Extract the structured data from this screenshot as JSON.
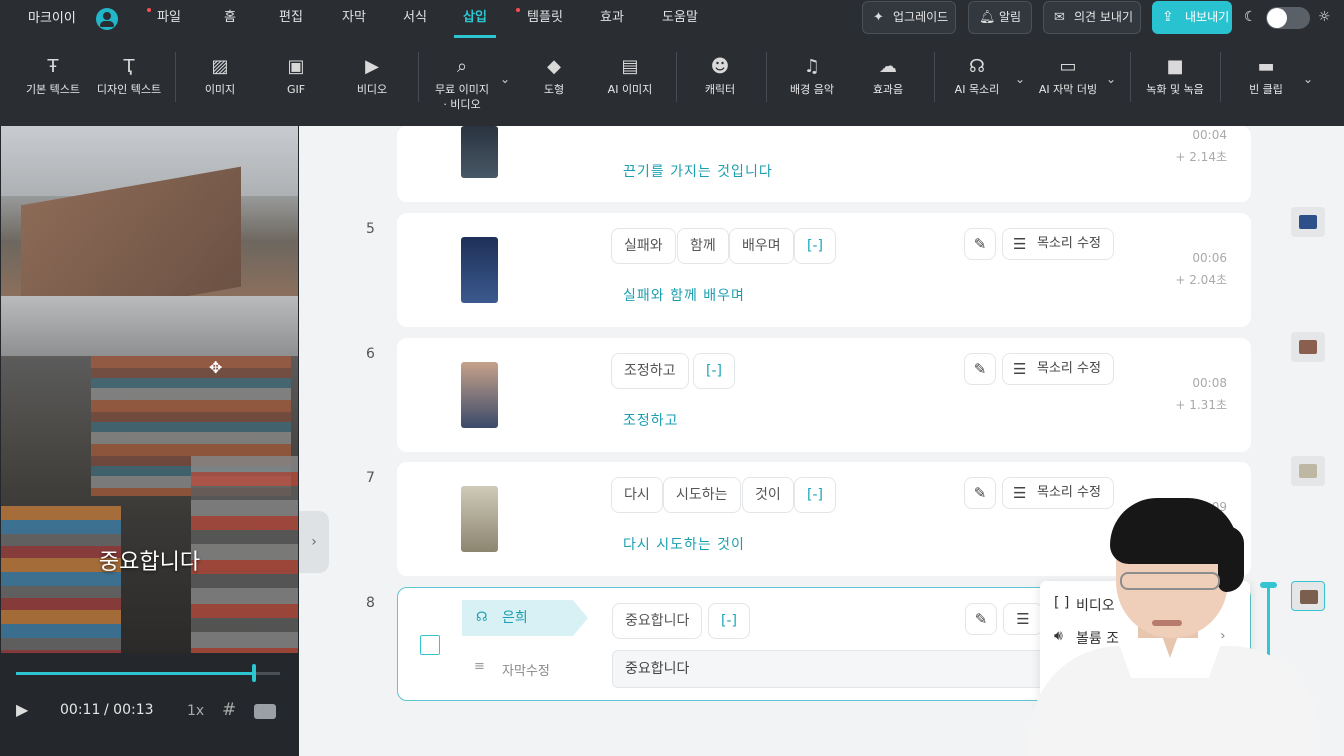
{
  "app": {
    "brand": "마크이이"
  },
  "menu": [
    {
      "label": "파일",
      "dot": true
    },
    {
      "label": "홈",
      "dot": false
    },
    {
      "label": "편집",
      "dot": false
    },
    {
      "label": "자막",
      "dot": false
    },
    {
      "label": "서식",
      "dot": false
    },
    {
      "label": "삽입",
      "dot": false,
      "active": true
    },
    {
      "label": "템플릿",
      "dot": true
    },
    {
      "label": "효과",
      "dot": false
    },
    {
      "label": "도움말",
      "dot": false
    }
  ],
  "topright": {
    "upgrade": "업그레이드",
    "notify": "알림",
    "feedback": "의견 보내기",
    "export": "내보내기"
  },
  "colors": {
    "accent": "#2ec5d3",
    "dark": "#2a2e33",
    "word_text": "#1b9fb0"
  },
  "toolbar": [
    {
      "label": "기본 텍스트",
      "icon": "text-icon"
    },
    {
      "label": "디자인 텍스트",
      "icon": "design-text-icon"
    },
    {
      "label": "이미지",
      "icon": "image-icon"
    },
    {
      "label": "GIF",
      "icon": "gif-icon"
    },
    {
      "label": "비디오",
      "icon": "video-icon"
    },
    {
      "label": "무료 이미지",
      "label2": "· 비디오",
      "icon": "free-media-icon"
    },
    {
      "label": "도형",
      "icon": "shape-icon"
    },
    {
      "label": "AI 이미지",
      "icon": "ai-image-icon"
    },
    {
      "label": "캐릭터",
      "icon": "character-icon"
    },
    {
      "label": "배경 음악",
      "icon": "music-icon"
    },
    {
      "label": "효과음",
      "icon": "sound-effect-icon"
    },
    {
      "label": "AI 목소리",
      "icon": "ai-voice-icon"
    },
    {
      "label": "AI 자막 더빙",
      "icon": "ai-dubbing-icon"
    },
    {
      "label": "녹화 및 녹음",
      "icon": "record-icon"
    },
    {
      "label": "빈 클립",
      "icon": "blank-clip-icon"
    }
  ],
  "preview": {
    "subtitle": "중요합니다",
    "current_time": "00:11",
    "total_time": "/ 00:13",
    "progress": 0.9,
    "speed": "1x"
  },
  "scenes": [
    {
      "num": "",
      "words": [],
      "line": "끈기를 가지는 것입니다",
      "time": "00:04",
      "dur": "+ 2.14초",
      "thumb": [
        "#2a3340",
        "#485866"
      ]
    },
    {
      "num": "5",
      "words": [
        "실패와",
        "함께",
        "배우며",
        "[-]"
      ],
      "line": "실패와 함께 배우며",
      "time": "00:06",
      "dur": "+ 2.04초",
      "thumb": [
        "#1e2f57",
        "#3b5a8f"
      ]
    },
    {
      "num": "6",
      "words": [
        "조정하고",
        "[-]"
      ],
      "line": "조정하고",
      "time": "00:08",
      "dur": "+ 1.31초",
      "thumb": [
        "#c7a28a",
        "#3a4a6a"
      ]
    },
    {
      "num": "7",
      "words": [
        "다시",
        "시도하는",
        "것이",
        "[-]"
      ],
      "line": "다시 시도하는 것이",
      "time": "00:09",
      "dur": "",
      "thumb": [
        "#cfcbb8",
        "#8c8570"
      ]
    }
  ],
  "selected_scene": {
    "num": "8",
    "speaker": "은희",
    "words": [
      "중요합니다",
      "[-]"
    ],
    "edit_label": "자막수정",
    "subtitle_value": "중요합니다"
  },
  "buttons": {
    "voice_edit": "목소리 수정"
  },
  "context_menu": {
    "item1": "비디오",
    "item2": "볼륨 조"
  }
}
